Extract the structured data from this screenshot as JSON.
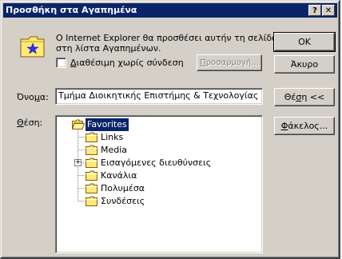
{
  "window": {
    "title": "Προσθήκη στα Αγαπημένα",
    "help_glyph": "?",
    "close_glyph": "✕"
  },
  "info": {
    "message_line1": "Ο Internet Explorer θα προσθέσει αυτήν τη σελίδα",
    "message_line2": "στη λίστα Αγαπημένων.",
    "offline_prefix": "",
    "offline_underline": "Δ",
    "offline_rest": "ιαθέσιμη χωρίς σύνδεση",
    "offline_checked": false
  },
  "buttons": {
    "ok": "OK",
    "cancel": "Άκυρο",
    "customize_u": "Π",
    "customize_rest": "ροσαρμογή...",
    "create_in_prefix": "Θέ",
    "create_in_u": "σ",
    "create_in_rest": "η <<",
    "new_folder_u": "Φ",
    "new_folder_rest": "άκελος..."
  },
  "name_field": {
    "label_prefix": "Όνο",
    "label_u": "μ",
    "label_rest": "α:",
    "value": "Τμήμα Διοικητικής Επιστήμης & Τεχνολογίας"
  },
  "location": {
    "label_u": "Θ",
    "label_rest": "έση:"
  },
  "tree": {
    "root": "Favorites",
    "items": [
      {
        "label": "Links",
        "expandable": false
      },
      {
        "label": "Media",
        "expandable": false
      },
      {
        "label": "Εισαγόμενες διευθύνσεις",
        "expandable": true,
        "expander_glyph": "+"
      },
      {
        "label": "Κανάλια",
        "expandable": false
      },
      {
        "label": "Πολυμέσα",
        "expandable": false
      },
      {
        "label": "Συνδέσεις",
        "expandable": false
      }
    ]
  },
  "colors": {
    "titlebar": "#0a246a",
    "face": "#d4d0c8",
    "selection": "#0a246a",
    "folder": "#ffe97a"
  },
  "icons": {
    "favorites_folder": "star-folder-icon",
    "folder": "folder-icon",
    "open_folder": "open-folder-icon"
  }
}
